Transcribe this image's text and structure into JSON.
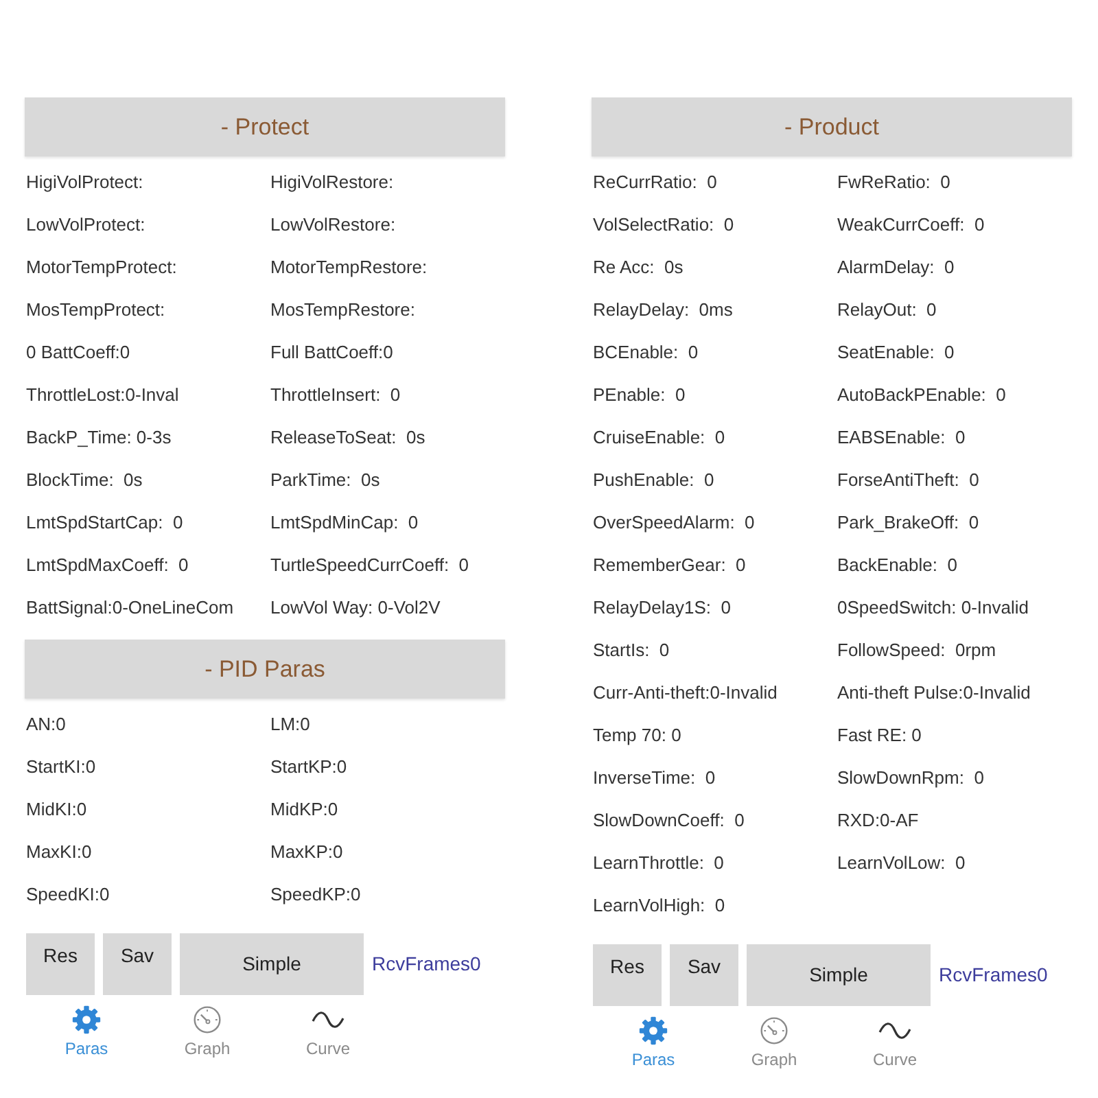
{
  "screens": [
    {
      "sections": [
        {
          "title": "- Protect",
          "fields": [
            "HigiVolProtect:",
            "HigiVolRestore:",
            "LowVolProtect:",
            "LowVolRestore:",
            "MotorTempProtect:",
            "MotorTempRestore:",
            "MosTempProtect:",
            "MosTempRestore:",
            "0 BattCoeff:0",
            "Full BattCoeff:0",
            "ThrottleLost:0-Inval",
            "ThrottleInsert:  0",
            "BackP_Time: 0-3s",
            "ReleaseToSeat:  0s",
            "BlockTime:  0s",
            "ParkTime:  0s",
            "LmtSpdStartCap:  0",
            "LmtSpdMinCap:  0",
            "LmtSpdMaxCoeff:  0",
            "TurtleSpeedCurrCoeff:  0",
            "BattSignal:0-OneLineCom",
            "LowVol Way: 0-Vol2V"
          ]
        },
        {
          "title": "- PID Paras",
          "fields": [
            "AN:0",
            "LM:0",
            "StartKI:0",
            "StartKP:0",
            "MidKI:0",
            "MidKP:0",
            "MaxKI:0",
            "MaxKP:0",
            "SpeedKI:0",
            "SpeedKP:0"
          ]
        }
      ],
      "buttons": [
        {
          "label": "Res",
          "kind": "narrow"
        },
        {
          "label": "Sav",
          "kind": "narrow"
        },
        {
          "label": "Simple",
          "kind": "wide"
        }
      ],
      "frames_counter": "RcvFrames0",
      "nav": [
        {
          "label": "Paras",
          "selected": true
        },
        {
          "label": "Graph",
          "selected": false
        },
        {
          "label": "Curve",
          "selected": false
        }
      ]
    },
    {
      "sections": [
        {
          "title": "- Product",
          "fields": [
            "ReCurrRatio:  0",
            "FwReRatio:  0",
            "VolSelectRatio:  0",
            "WeakCurrCoeff:  0",
            "Re Acc:  0s",
            "AlarmDelay:  0",
            "RelayDelay:  0ms",
            "RelayOut:  0",
            "BCEnable:  0",
            "SeatEnable:  0",
            "PEnable:  0",
            "AutoBackPEnable:  0",
            "CruiseEnable:  0",
            "EABSEnable:  0",
            "PushEnable:  0",
            "ForseAntiTheft:  0",
            "OverSpeedAlarm:  0",
            "Park_BrakeOff:  0",
            "RememberGear:  0",
            "BackEnable:  0",
            "RelayDelay1S:  0",
            "0SpeedSwitch: 0-Invalid",
            "StartIs:  0",
            "FollowSpeed:  0rpm",
            "Curr-Anti-theft:0-Invalid",
            "Anti-theft Pulse:0-Invalid",
            "Temp 70: 0",
            "Fast RE: 0",
            "InverseTime:  0",
            "SlowDownRpm:  0",
            "SlowDownCoeff:  0",
            "RXD:0-AF",
            "LearnThrottle:  0",
            "LearnVolLow:  0",
            "LearnVolHigh:  0"
          ]
        }
      ],
      "buttons": [
        {
          "label": "Res",
          "kind": "narrow"
        },
        {
          "label": "Sav",
          "kind": "narrow"
        },
        {
          "label": "Simple",
          "kind": "wide"
        }
      ],
      "frames_counter": "RcvFrames0",
      "nav": [
        {
          "label": "Paras",
          "selected": true
        },
        {
          "label": "Graph",
          "selected": false
        },
        {
          "label": "Curve",
          "selected": false
        }
      ]
    }
  ]
}
